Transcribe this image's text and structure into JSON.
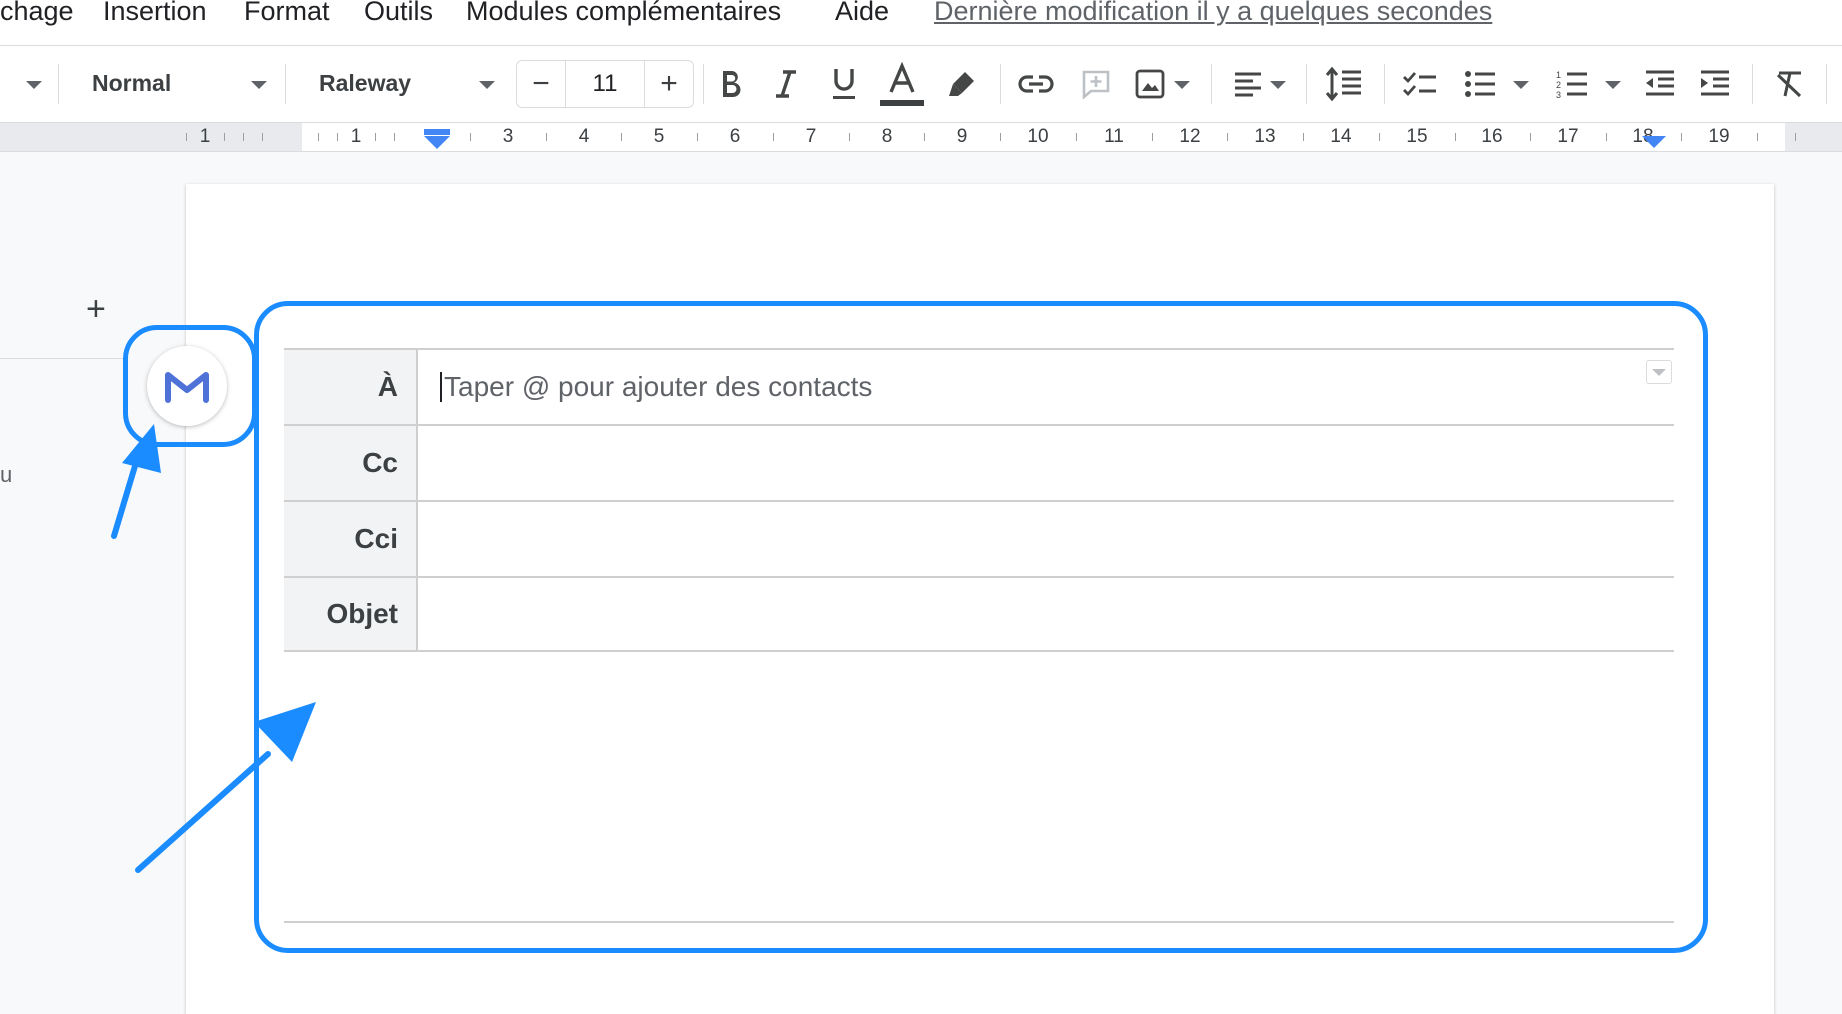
{
  "menu": {
    "items": [
      "chage",
      "Insertion",
      "Format",
      "Outils",
      "Modules complémentaires",
      "Aide"
    ],
    "last_modified": "Dernière modification il y a quelques secondes"
  },
  "toolbar": {
    "style": "Normal",
    "font": "Raleway",
    "font_size_decrease": "−",
    "font_size": "11",
    "font_size_increase": "+"
  },
  "ruler": {
    "numbers": [
      "1",
      "1",
      "3",
      "4",
      "5",
      "6",
      "7",
      "8",
      "9",
      "10",
      "11",
      "12",
      "13",
      "14",
      "15",
      "16",
      "17",
      "18",
      "19"
    ]
  },
  "gutter": {
    "plus": "+",
    "partial_text": "u"
  },
  "email_draft": {
    "to_label": "À",
    "to_placeholder": "Taper @ pour ajouter des contacts",
    "cc_label": "Cc",
    "bcc_label": "Cci",
    "subject_label": "Objet"
  },
  "colors": {
    "callout": "#1a8cff",
    "gmail_icon": "#4f72d9"
  }
}
